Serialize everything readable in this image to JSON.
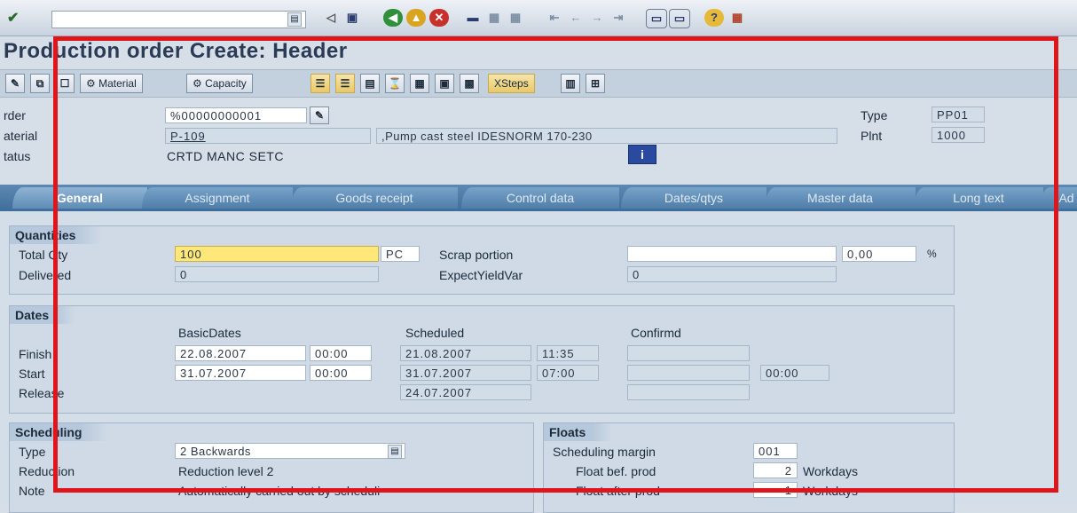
{
  "toolbar": {
    "command_value": "",
    "buttons": [
      "enter-icon",
      "save-icon",
      "back-icon",
      "exit-icon",
      "cancel-icon",
      "print-icon",
      "find-icon",
      "find-next-icon",
      "first-page-icon",
      "prev-page-icon",
      "next-page-icon",
      "last-page-icon",
      "new-session-icon",
      "shortcut-icon",
      "help-icon",
      "layout-icon"
    ]
  },
  "title": "Production order Create: Header",
  "app_toolbar": {
    "material_label": "Material",
    "capacity_label": "Capacity",
    "xsteps_label": "XSteps"
  },
  "header": {
    "order_label": "rder",
    "order_value": "%00000000001",
    "material_label": "aterial",
    "material_value": "P-109",
    "material_desc": ",Pump cast steel IDESNORM 170-230",
    "status_label": "tatus",
    "status_value": "CRTD MANC SETC",
    "type_label": "Type",
    "type_value": "PP01",
    "plant_label": "Plnt",
    "plant_value": "1000"
  },
  "tabs": [
    "General",
    "Assignment",
    "Goods receipt",
    "Control data",
    "Dates/qtys",
    "Master data",
    "Long text",
    "Ad"
  ],
  "quantities": {
    "title": "Quantities",
    "total_label": "Total Qty",
    "total_value": "100",
    "unit": "PC",
    "delivered_label": "Delivered",
    "delivered_value": "0",
    "scrap_label": "Scrap portion",
    "scrap_value": "",
    "scrap_pct": "0,00",
    "pct_sign": "%",
    "yield_label": "ExpectYieldVar",
    "yield_value": "0"
  },
  "dates": {
    "title": "Dates",
    "basic_head": "BasicDates",
    "sched_head": "Scheduled",
    "conf_head": "Confirmd",
    "finish_label": "Finish",
    "start_label": "Start",
    "release_label": "Release",
    "basic_finish_date": "22.08.2007",
    "basic_finish_time": "00:00",
    "basic_start_date": "31.07.2007",
    "basic_start_time": "00:00",
    "sched_finish_date": "21.08.2007",
    "sched_finish_time": "11:35",
    "sched_start_date": "31.07.2007",
    "sched_start_time": "07:00",
    "sched_release_date": "24.07.2007",
    "conf_start_time": "00:00"
  },
  "scheduling": {
    "title": "Scheduling",
    "type_label": "Type",
    "type_value": "2 Backwards",
    "reduction_label": "Reduction",
    "reduction_value": "Reduction level 2",
    "note_label": "Note",
    "note_value": "Automatically carried out by scheduli"
  },
  "floats": {
    "title": "Floats",
    "margin_label": "Scheduling margin",
    "margin_value": "001",
    "before_label": "Float bef. prod",
    "before_value": "2",
    "before_unit": "Workdays",
    "after_label": "Float after prod",
    "after_value": "1",
    "after_unit": "Workdays"
  },
  "colors": {
    "highlight_border": "#e0141b",
    "tab_bar": "#4f7ea9",
    "required_field": "#ffe77a"
  }
}
